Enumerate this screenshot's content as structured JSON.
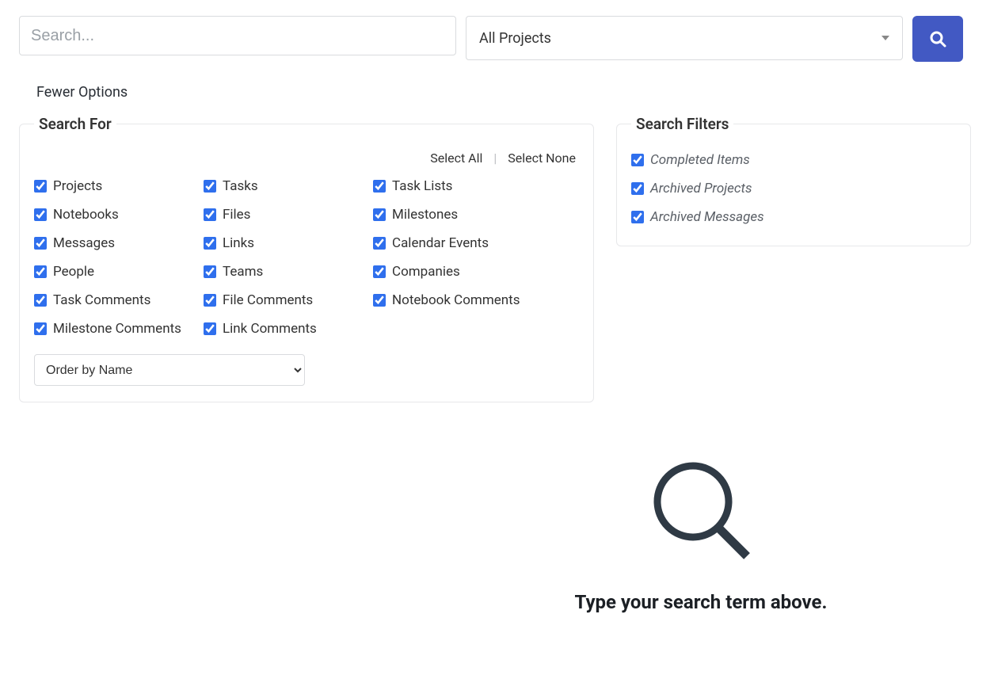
{
  "top": {
    "search_placeholder": "Search...",
    "project_selector": "All Projects"
  },
  "fewer_options": "Fewer Options",
  "search_for": {
    "legend": "Search For",
    "select_all": "Select All",
    "select_none": "Select None",
    "items": [
      "Projects",
      "Tasks",
      "Task Lists",
      "Notebooks",
      "Files",
      "Milestones",
      "Messages",
      "Links",
      "Calendar Events",
      "People",
      "Teams",
      "Companies",
      "Task Comments",
      "File Comments",
      "Notebook Comments",
      "Milestone Comments",
      "Link Comments"
    ],
    "order_by": "Order by Name"
  },
  "filters": {
    "legend": "Search Filters",
    "items": [
      "Completed Items",
      "Archived Projects",
      "Archived Messages"
    ]
  },
  "empty_message": "Type your search term above."
}
